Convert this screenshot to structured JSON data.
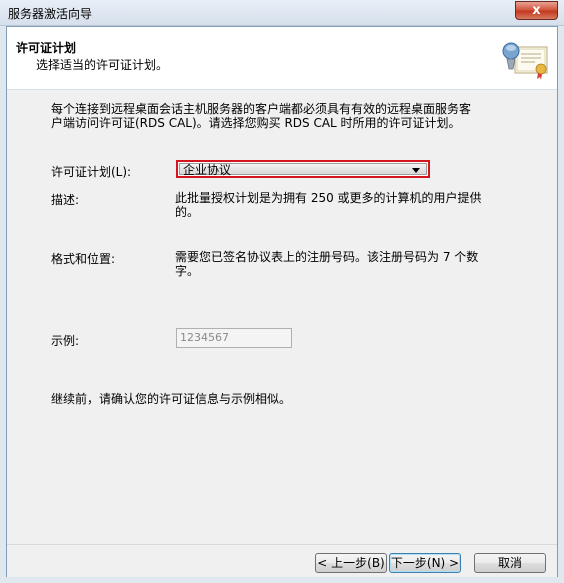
{
  "window": {
    "title": "服务器激活向导",
    "close_glyph": "x"
  },
  "header": {
    "title": "许可证计划",
    "subtitle": "选择适当的许可证计划。",
    "icon": "certificate-icon"
  },
  "content": {
    "intro": "每个连接到远程桌面会话主机服务器的客户端都必须具有有效的远程桌面服务客户端访问许可证(RDS CAL)。请选择您购买 RDS CAL 时所用的许可证计划。",
    "plan_label": "许可证计划(L):",
    "plan_selected": "企业协议",
    "desc_label": "描述:",
    "desc_value": "此批量授权计划是为拥有 250 或更多的计算机的用户提供的。",
    "format_label": "格式和位置:",
    "format_value": "需要您已签名协议表上的注册号码。该注册号码为 7 个数字。",
    "example_label": "示例:",
    "example_value": "1234567",
    "confirm_text": "继续前，请确认您的许可证信息与示例相似。"
  },
  "footer": {
    "back_label": "< 上一步(B)",
    "next_label": "下一步(N) >",
    "cancel_label": "取消"
  },
  "colors": {
    "highlight_border": "#d4141e",
    "close_button": "#c23a1f"
  }
}
